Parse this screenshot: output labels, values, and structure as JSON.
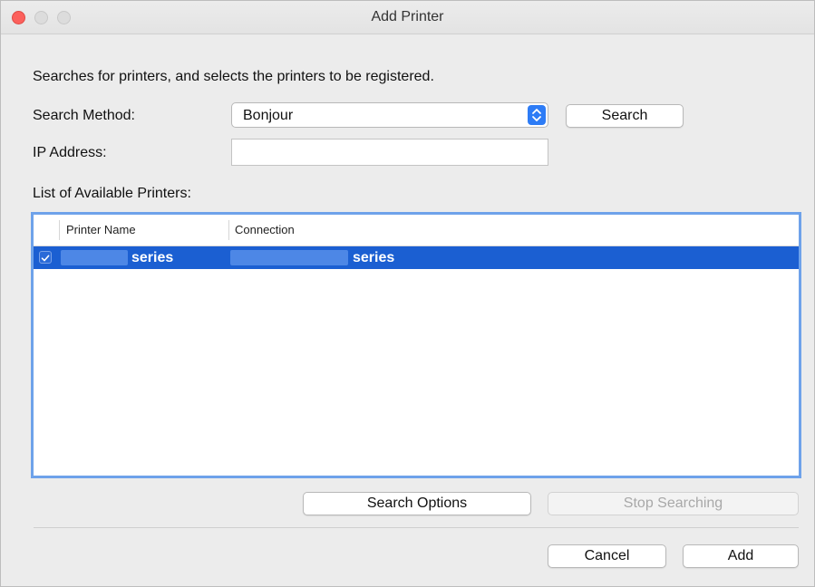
{
  "window": {
    "title": "Add Printer"
  },
  "dialog": {
    "description": "Searches for printers, and selects the printers to be registered.",
    "search_method_label": "Search Method:",
    "search_method_value": "Bonjour",
    "search_button": "Search",
    "ip_address_label": "IP Address:",
    "ip_address_value": "",
    "list_label": "List of Available Printers:"
  },
  "table": {
    "columns": [
      "Printer Name",
      "Connection"
    ],
    "rows": [
      {
        "checked": true,
        "printer_name": "series",
        "connection": "series"
      }
    ]
  },
  "buttons": {
    "search_options": "Search Options",
    "stop_searching": "Stop Searching",
    "cancel": "Cancel",
    "add": "Add"
  },
  "colors": {
    "selection": "#1b5fd2",
    "list_focus_ring": "#6ea2ea",
    "close_button": "#fc605c"
  }
}
